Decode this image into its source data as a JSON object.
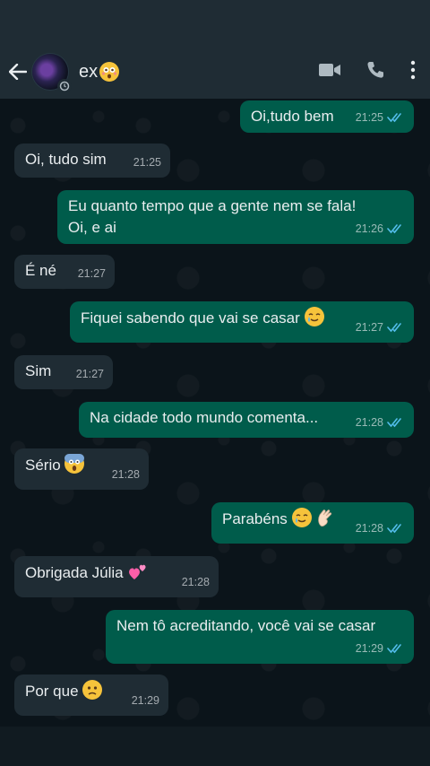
{
  "header": {
    "contact_name": "ex",
    "icons": [
      "back-arrow-icon",
      "video-call-icon",
      "voice-call-icon",
      "more-options-icon"
    ]
  },
  "colors": {
    "incoming_bubble": "#1f2c34",
    "outgoing_bubble": "#005c4b",
    "read_ticks": "#53bdeb"
  },
  "messages": [
    {
      "dir": "out",
      "text": "Oi,tudo bem",
      "time": "21:25",
      "status": "read"
    },
    {
      "dir": "in",
      "text": "Oi, tudo sim",
      "time": "21:25"
    },
    {
      "dir": "out",
      "text": "Eu quanto tempo que a gente nem se fala!\nOi, e ai",
      "time": "21:26",
      "status": "read"
    },
    {
      "dir": "in",
      "text": "É né",
      "time": "21:27"
    },
    {
      "dir": "out",
      "text": "Fiquei sabendo que vai se casar",
      "emoji": "crying-smile-emoji",
      "time": "21:27",
      "status": "read"
    },
    {
      "dir": "in",
      "text": "Sim",
      "time": "21:27"
    },
    {
      "dir": "out",
      "text": "Na cidade todo mundo comenta...",
      "time": "21:28",
      "status": "read"
    },
    {
      "dir": "in",
      "text": "Sério",
      "emoji": "screaming-face-emoji",
      "time": "21:28"
    },
    {
      "dir": "out",
      "text": "Parabéns",
      "emoji": "crying-smile-emoji clapping-hands-emoji",
      "time": "21:28",
      "status": "read"
    },
    {
      "dir": "in",
      "text": "Obrigada Júlia",
      "emoji": "two-hearts-emoji",
      "time": "21:28"
    },
    {
      "dir": "out",
      "text": "Nem tô acreditando, você vai se casar",
      "time": "21:29",
      "status": "read"
    },
    {
      "dir": "in",
      "text": "Por que",
      "emoji": "slightly-frowning-face-emoji",
      "time": "21:29"
    }
  ]
}
